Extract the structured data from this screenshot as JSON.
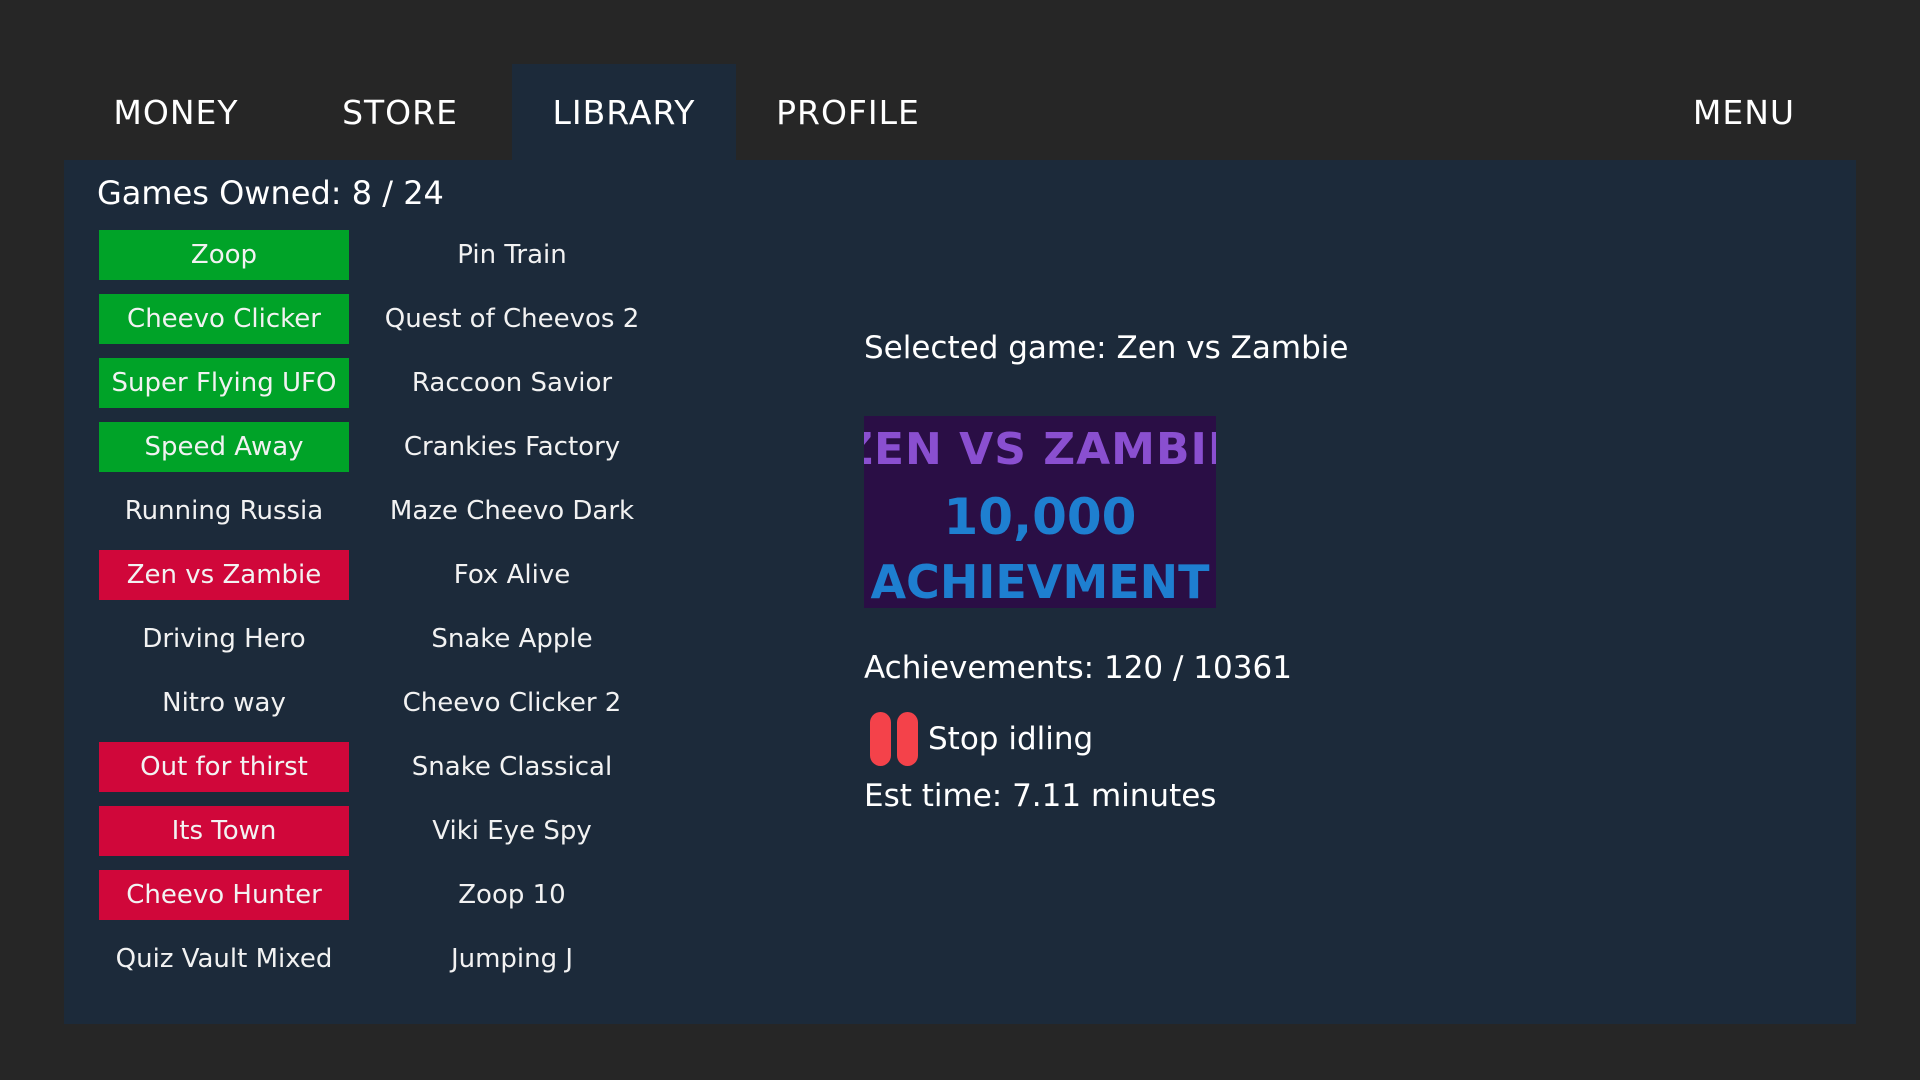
{
  "nav": {
    "tabs": [
      {
        "label": "MONEY"
      },
      {
        "label": "STORE"
      },
      {
        "label": "LIBRARY"
      },
      {
        "label": "PROFILE"
      }
    ],
    "menu_label": "MENU",
    "active_tab": "LIBRARY"
  },
  "library": {
    "games_owned_text": "Games Owned: 8 / 24",
    "status_colors": {
      "owned_complete": "#00a328",
      "owned_in_progress": "#d0073a"
    },
    "column1": [
      {
        "name": "Zoop",
        "status": "green"
      },
      {
        "name": "Cheevo Clicker",
        "status": "green"
      },
      {
        "name": "Super Flying UFO",
        "status": "green"
      },
      {
        "name": "Speed Away",
        "status": "green"
      },
      {
        "name": "Running Russia",
        "status": "none"
      },
      {
        "name": "Zen vs Zambie",
        "status": "red"
      },
      {
        "name": "Driving Hero",
        "status": "none"
      },
      {
        "name": "Nitro way",
        "status": "none"
      },
      {
        "name": "Out for thirst",
        "status": "red"
      },
      {
        "name": "Its Town",
        "status": "red"
      },
      {
        "name": "Cheevo Hunter",
        "status": "red"
      },
      {
        "name": "Quiz Vault Mixed",
        "status": "none"
      }
    ],
    "column2": [
      {
        "name": "Pin Train",
        "status": "none"
      },
      {
        "name": "Quest of Cheevos 2",
        "status": "none"
      },
      {
        "name": "Raccoon Savior",
        "status": "none"
      },
      {
        "name": "Crankies Factory",
        "status": "none"
      },
      {
        "name": "Maze Cheevo Dark",
        "status": "none"
      },
      {
        "name": "Fox Alive",
        "status": "none"
      },
      {
        "name": "Snake Apple",
        "status": "none"
      },
      {
        "name": "Cheevo Clicker 2",
        "status": "none"
      },
      {
        "name": "Snake Classical",
        "status": "none"
      },
      {
        "name": "Viki Eye Spy",
        "status": "none"
      },
      {
        "name": "Zoop 10",
        "status": "none"
      },
      {
        "name": "Jumping J",
        "status": "none"
      }
    ]
  },
  "selected": {
    "title_text": "Selected game: Zen vs Zambie",
    "cover_lines": [
      "ZEN VS ZAMBIE",
      "10,000",
      "ACHIEVMENT"
    ],
    "achievements_text": "Achievements: 120 / 10361",
    "idle_button_label": "Stop idling",
    "idle_icon": "pause-icon",
    "est_time_text": "Est time: 7.11 minutes"
  }
}
